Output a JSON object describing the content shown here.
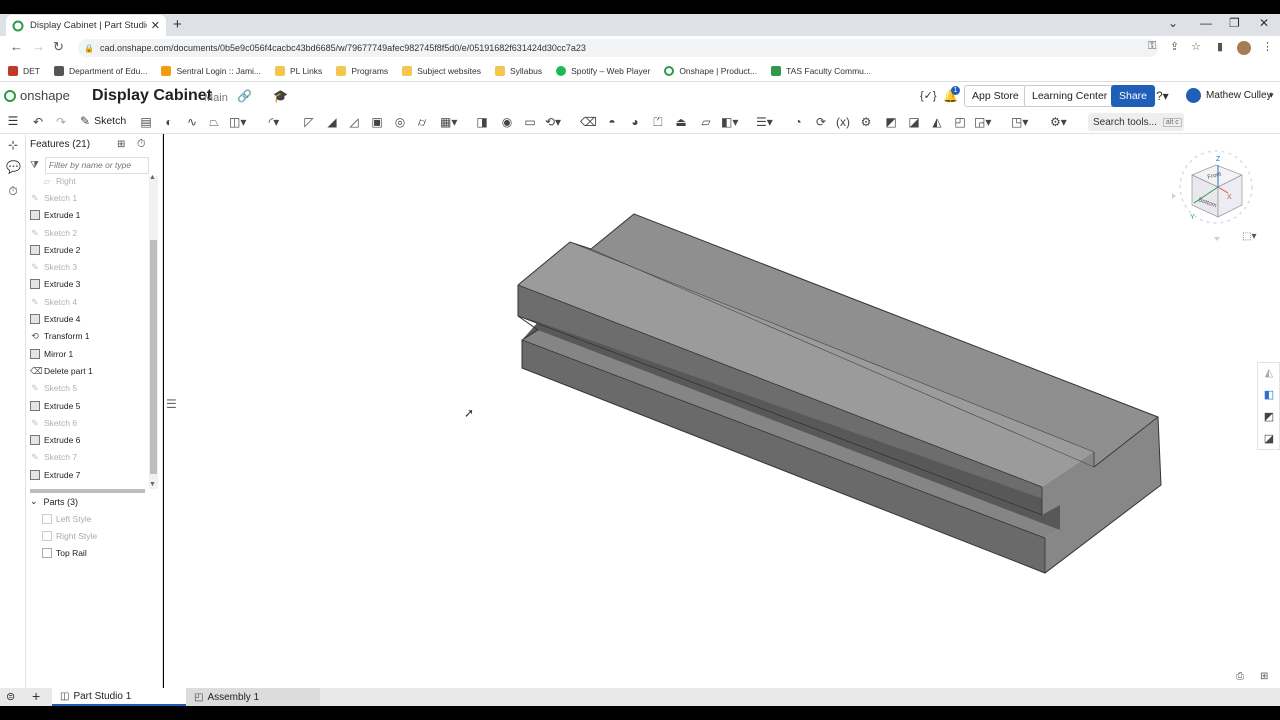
{
  "browser": {
    "tab_title": "Display Cabinet | Part Studio 1",
    "tab_close": "✕",
    "new_tab": "+",
    "url": "cad.onshape.com/documents/0b5e9c056f4cacbc43bd6685/w/79677749afec982745f8f5d0/e/05191682f631424d30cc7a23",
    "window_controls": {
      "min": "—",
      "restore": "❐",
      "close": "✕",
      "chevron": "⌄"
    },
    "bookmarks": [
      {
        "label": "DET",
        "color": "#c0392b"
      },
      {
        "label": "Department of Edu...",
        "color": "#555555"
      },
      {
        "label": "Sentral Login :: Jami...",
        "color": "#f39c12"
      },
      {
        "label": "PL Links",
        "color": "#f3c74d"
      },
      {
        "label": "Programs",
        "color": "#f3c74d"
      },
      {
        "label": "Subject websites",
        "color": "#f3c74d"
      },
      {
        "label": "Syllabus",
        "color": "#f3c74d"
      },
      {
        "label": "Spotify – Web Player",
        "color": "#1db954"
      },
      {
        "label": "Onshape | Product...",
        "color": "#2d9a4c"
      },
      {
        "label": "TAS Faculty Commu...",
        "color": "#2d9a4c"
      }
    ]
  },
  "app": {
    "logo_text": "onshape",
    "document_name": "Display Cabinet",
    "branch": "Main",
    "notification_count": "1",
    "variable_icon": "{✓}",
    "app_store": "App Store",
    "learning_center": "Learning Center",
    "share": "Share",
    "user_name": "Mathew Culley",
    "brand_color": "#1f5fb8"
  },
  "toolbar": {
    "sketch_label": "Sketch",
    "search_tools": "Search tools...",
    "search_shortcut": "alt c"
  },
  "features": {
    "header": "Features (21)",
    "filter_placeholder": "Filter by name or type",
    "items": [
      {
        "label": "Right",
        "kind": "plane"
      },
      {
        "label": "Sketch 1",
        "kind": "sketch"
      },
      {
        "label": "Extrude 1",
        "kind": "extrude"
      },
      {
        "label": "Sketch 2",
        "kind": "sketch"
      },
      {
        "label": "Extrude 2",
        "kind": "extrude"
      },
      {
        "label": "Sketch 3",
        "kind": "sketch"
      },
      {
        "label": "Extrude 3",
        "kind": "extrude"
      },
      {
        "label": "Sketch 4",
        "kind": "sketch"
      },
      {
        "label": "Extrude 4",
        "kind": "extrude"
      },
      {
        "label": "Transform 1",
        "kind": "transform"
      },
      {
        "label": "Mirror 1",
        "kind": "mirror"
      },
      {
        "label": "Delete part 1",
        "kind": "delete"
      },
      {
        "label": "Sketch 5",
        "kind": "sketch"
      },
      {
        "label": "Extrude 5",
        "kind": "extrude"
      },
      {
        "label": "Sketch 6",
        "kind": "sketch"
      },
      {
        "label": "Extrude 6",
        "kind": "extrude"
      },
      {
        "label": "Sketch 7",
        "kind": "sketch"
      },
      {
        "label": "Extrude 7",
        "kind": "extrude"
      }
    ]
  },
  "parts": {
    "header": "Parts (3)",
    "items": [
      {
        "label": "Left Style",
        "hidden": true
      },
      {
        "label": "Right Style",
        "hidden": true
      },
      {
        "label": "Top Rail",
        "hidden": false
      }
    ]
  },
  "viewcube": {
    "top": "Front",
    "bottom": "Bottom",
    "axis_z": "Z",
    "axis_x": "X",
    "axis_y": "Y"
  },
  "bottom_tabs": [
    {
      "label": "Part Studio 1",
      "active": true
    },
    {
      "label": "Assembly 1",
      "active": false
    }
  ]
}
